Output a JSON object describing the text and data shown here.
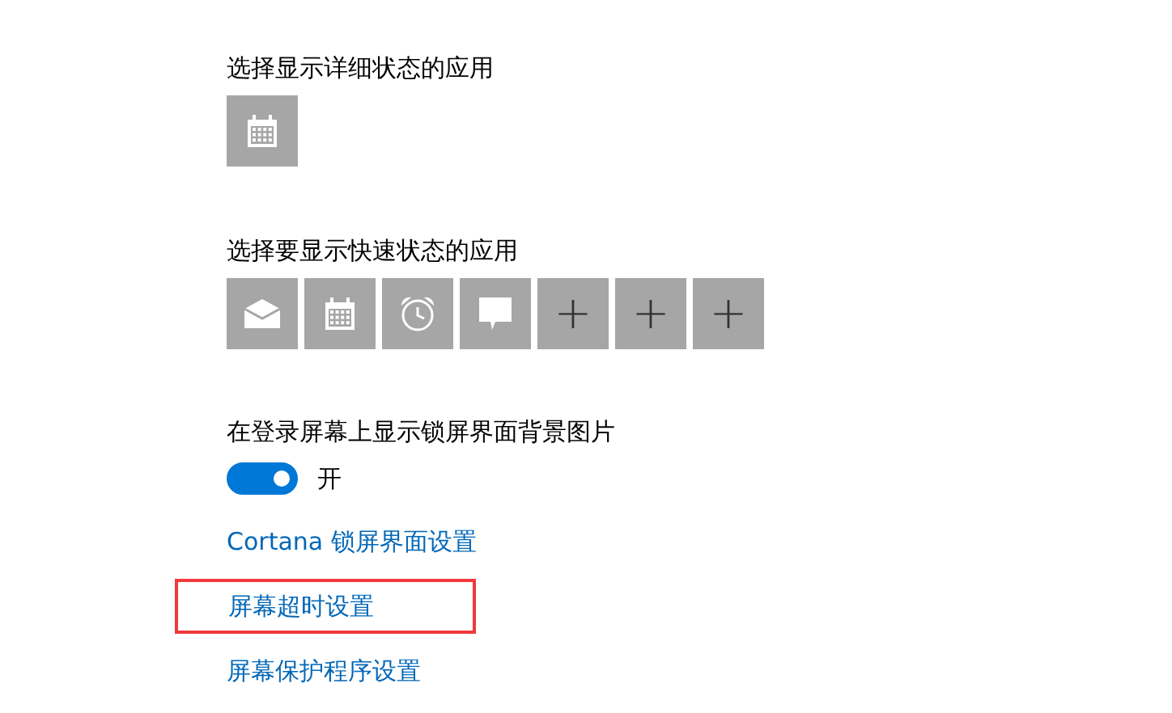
{
  "detailed_status": {
    "label": "选择显示详细状态的应用",
    "apps": [
      {
        "kind": "calendar"
      }
    ]
  },
  "quick_status": {
    "label": "选择要显示快速状态的应用",
    "apps": [
      {
        "kind": "mail"
      },
      {
        "kind": "calendar"
      },
      {
        "kind": "alarm"
      },
      {
        "kind": "message"
      },
      {
        "kind": "add",
        "text": "+"
      },
      {
        "kind": "add",
        "text": "+"
      },
      {
        "kind": "add",
        "text": "+"
      }
    ]
  },
  "background_setting": {
    "label": "在登录屏幕上显示锁屏界面背景图片",
    "toggle": {
      "on": true,
      "text": "开"
    }
  },
  "links": [
    {
      "text": "Cortana 锁屏界面设置",
      "highlighted": false
    },
    {
      "text": "屏幕超时设置",
      "highlighted": true
    },
    {
      "text": "屏幕保护程序设置",
      "highlighted": false
    }
  ]
}
